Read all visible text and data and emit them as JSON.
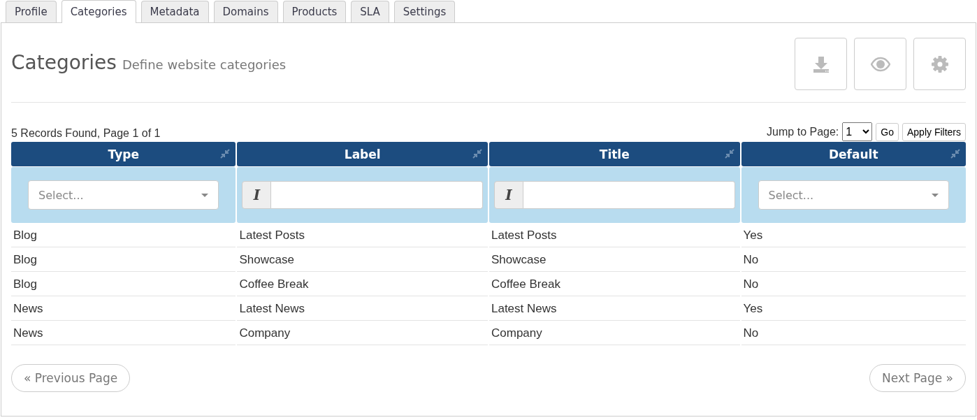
{
  "tabs": [
    {
      "label": "Profile",
      "selected": false
    },
    {
      "label": "Categories",
      "selected": true
    },
    {
      "label": "Metadata",
      "selected": false
    },
    {
      "label": "Domains",
      "selected": false
    },
    {
      "label": "Products",
      "selected": false
    },
    {
      "label": "SLA",
      "selected": false
    },
    {
      "label": "Settings",
      "selected": false
    }
  ],
  "header": {
    "title": "Categories",
    "subtitle": "Define website categories"
  },
  "toolbar": [
    {
      "kind": "download"
    },
    {
      "kind": "view"
    },
    {
      "kind": "settings"
    }
  ],
  "records_summary": "5 Records Found, Page 1 of 1",
  "jump": {
    "label": "Jump to Page:",
    "value": "1",
    "go": "Go",
    "apply": "Apply Filters"
  },
  "table": {
    "columns": [
      {
        "title": "Type",
        "filter": {
          "kind": "select",
          "placeholder": "Select..."
        }
      },
      {
        "title": "Label",
        "filter": {
          "kind": "text",
          "prefix": "I"
        }
      },
      {
        "title": "Title",
        "filter": {
          "kind": "text",
          "prefix": "I"
        }
      },
      {
        "title": "Default",
        "filter": {
          "kind": "select",
          "placeholder": "Select..."
        }
      }
    ],
    "rows": [
      [
        "Blog",
        "Latest Posts",
        "Latest Posts",
        "Yes"
      ],
      [
        "Blog",
        "Showcase",
        "Showcase",
        "No"
      ],
      [
        "Blog",
        "Coffee Break",
        "Coffee Break",
        "No"
      ],
      [
        "News",
        "Latest News",
        "Latest News",
        "Yes"
      ],
      [
        "News",
        "Company",
        "Company",
        "No"
      ]
    ]
  },
  "pagination": {
    "previous": "« Previous Page",
    "next": "Next Page »"
  }
}
